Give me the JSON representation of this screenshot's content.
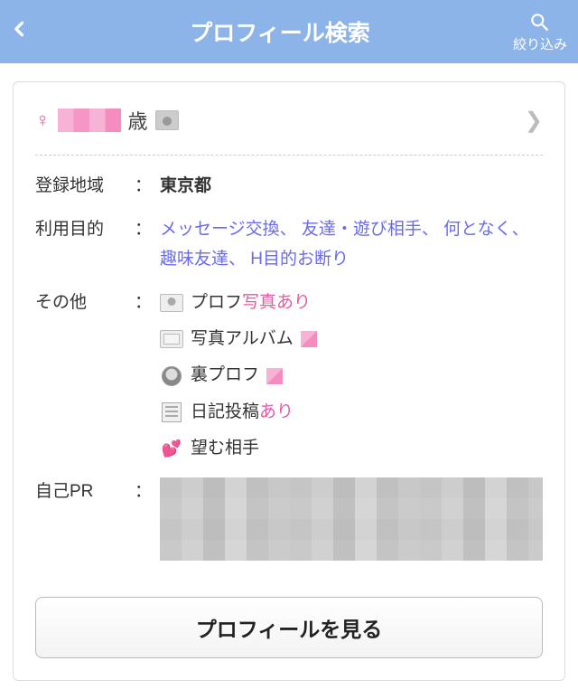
{
  "header": {
    "title": "プロフィール検索",
    "filter_label": "絞り込み"
  },
  "profile": {
    "age_suffix": "歳",
    "fields": {
      "region_label": "登録地域",
      "region_value": "東京都",
      "purpose_label": "利用目的",
      "purpose_value": "メッセージ交換、 友達・遊び相手、 何となく、 趣味友達、 H目的お断り",
      "other_label": "その他",
      "pr_label": "自己PR"
    },
    "other_items": {
      "photo_prefix": "プロフ",
      "photo_suffix": "写真あり",
      "album_label": "写真アルバム",
      "ura_label": "裏プロフ",
      "diary_prefix": "日記投稿",
      "diary_suffix": "あり",
      "desire_label": "望む相手"
    },
    "view_button": "プロフィールを見る"
  }
}
